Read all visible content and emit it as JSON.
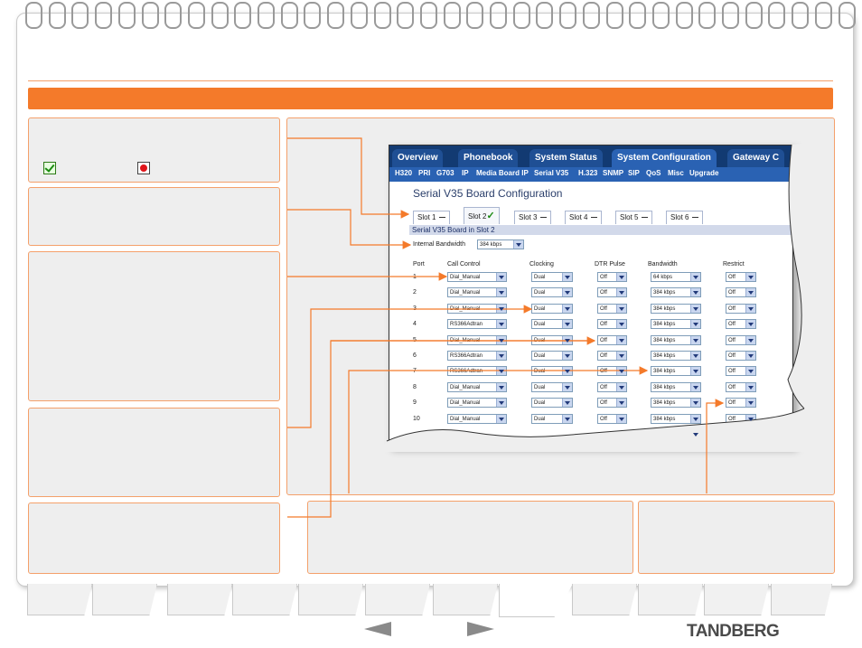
{
  "shot": {
    "tabs": [
      "Overview",
      "Phonebook",
      "System Status",
      "System Configuration",
      "Gateway C"
    ],
    "subtabs": [
      "H320",
      "PRI",
      "G703",
      "IP",
      "Media Board IP",
      "Serial V35",
      "H.323",
      "SNMP",
      "SIP",
      "QoS",
      "Misc",
      "Upgrade"
    ],
    "title": "Serial V35 Board Configuration",
    "slots": [
      "Slot 1",
      "Slot 2",
      "Slot 3",
      "Slot 4",
      "Slot 5",
      "Slot 6"
    ],
    "board_heading": "Serial V35 Board in Slot 2",
    "internal_bw_label": "Internal Bandwidth",
    "internal_bw_value": "384 kbps",
    "columns": [
      "Port",
      "Call Control",
      "Clocking",
      "DTR Pulse",
      "Bandwidth",
      "Restrict"
    ],
    "rows": [
      [
        "1",
        "Dial_Manual",
        "Dual",
        "Off",
        "64 kbps",
        "Off"
      ],
      [
        "2",
        "Dial_Manual",
        "Dual",
        "Off",
        "384 kbps",
        "Off"
      ],
      [
        "3",
        "Dial_Manual",
        "Dual",
        "Off",
        "384 kbps",
        "Off"
      ],
      [
        "4",
        "RS366Adtran",
        "Dual",
        "Off",
        "384 kbps",
        "Off"
      ],
      [
        "5",
        "Dial_Manual",
        "Dual",
        "Off",
        "384 kbps",
        "Off"
      ],
      [
        "6",
        "RS366Adtran",
        "Dual",
        "Off",
        "384 kbps",
        "Off"
      ],
      [
        "7",
        "RS366Adtran",
        "Dual",
        "Off",
        "384 kbps",
        "Off"
      ],
      [
        "8",
        "Dial_Manual",
        "Dual",
        "Off",
        "384 kbps",
        "Off"
      ],
      [
        "9",
        "Dial_Manual",
        "Dual",
        "Off",
        "384 kbps",
        "Off"
      ],
      [
        "10",
        "Dial_Manual",
        "Dual",
        "Off",
        "384 kbps",
        "Off"
      ],
      [
        "",
        "",
        "",
        "",
        "384 kbps",
        ""
      ]
    ]
  },
  "brand": "TANDBERG",
  "colors": {
    "accent": "#f47a2a",
    "panel": "#eeeeee",
    "tabbar": "#123a72"
  },
  "icons": [
    "check-icon",
    "red-dot-icon",
    "prev-arrow-icon",
    "next-arrow-icon"
  ]
}
